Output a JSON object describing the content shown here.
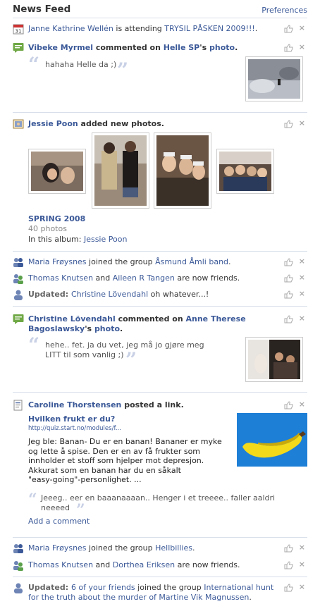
{
  "header": {
    "title": "News Feed",
    "preferences": "Preferences"
  },
  "s1": {
    "actor": "Janne Kathrine Wellén",
    "verb": " is attending ",
    "event": "TRYSIL PÅSKEN 2009!!!",
    "end": "."
  },
  "s2": {
    "actor": "Vibeke Myrmel",
    "verb": " commented on ",
    "owner": "Helle SP",
    "poss": "'s ",
    "obj": "photo",
    "end": ".",
    "comment": "hahaha Helle da ;)"
  },
  "s3": {
    "actor": "Jessie Poon",
    "verb": " added new photos.",
    "album_title": "SPRING 2008",
    "count": "40 photos",
    "in_album": "In this album: ",
    "album_person": "Jessie Poon"
  },
  "s4": {
    "actor": "Maria Frøysnes",
    "verb": " joined the group ",
    "group": "Åsmund Åmli band",
    "end": "."
  },
  "s5": {
    "a": "Thomas Knutsen",
    "and": " and ",
    "b": "Aileen R Tangen",
    "end": " are now friends."
  },
  "s6": {
    "label": "Updated: ",
    "actor": "Christine Lövendahl",
    "status": " oh whatever...!"
  },
  "s7": {
    "actor": "Christine Lövendahl",
    "verb": " commented on ",
    "owner_line1": "Anne Therese",
    "owner_line2": "Bagoslawsky",
    "poss": "'s ",
    "obj": "photo",
    "end": ".",
    "comment_l1": "hehe.. fet. ja du vet, jeg må jo gjøre meg",
    "comment_l2": "LITT til som vanlig ;)"
  },
  "s8": {
    "actor": "Caroline Thorstensen",
    "verb": " posted a link.",
    "link_title": "Hvilken frukt er du?",
    "link_url": "http://quiz.start.no/modules/f...",
    "desc": [
      "Jeg ble: Banan- Du er en banan! Bananer er myke",
      "og lette å spise. Den er en av få frukter som",
      "innholder et stoff som hjelper mot depresjon.",
      "Akkurat som en banan har du en såkalt",
      "\"easy-going\"-personlighet. ..."
    ],
    "comment_l1": "Jeeeg.. eer en baaanaaaan.. Henger i et treeee.. faller aaldri",
    "comment_l2": "neeeed",
    "add_comment": "Add a comment"
  },
  "s9": {
    "actor": "Maria Frøysnes",
    "verb": " joined the group ",
    "group": "Hellbillies",
    "end": "."
  },
  "s10": {
    "a": "Thomas Knutsen",
    "and": " and ",
    "b": "Dorthea Eriksen",
    "end": " are now friends."
  },
  "s11": {
    "label": "Updated: ",
    "friends": "6 of your friends",
    "verb": " joined the group ",
    "group_l1": "International hunt",
    "group_l2": "for the truth about the murder of Martine Vik Magnussen",
    "end": "."
  },
  "colors": {
    "link": "#3b5998",
    "divider": "#d8dfea",
    "quote": "#c9d1e6"
  }
}
